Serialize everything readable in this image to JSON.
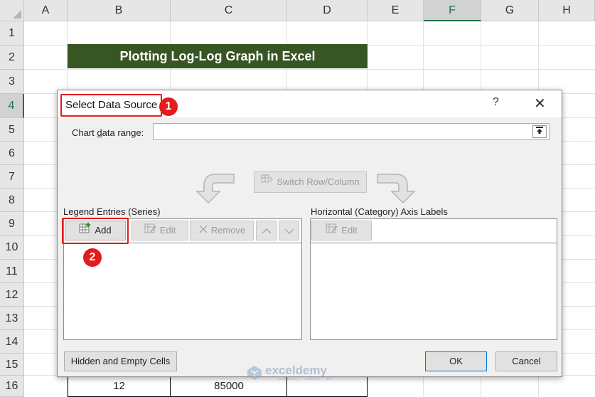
{
  "spreadsheet": {
    "columns": [
      "A",
      "B",
      "C",
      "D",
      "E",
      "F",
      "G",
      "H"
    ],
    "selected_column": "F",
    "rows": [
      "1",
      "2",
      "3",
      "4",
      "5",
      "6",
      "7",
      "8",
      "9",
      "10",
      "11",
      "12",
      "13",
      "14",
      "15",
      "16"
    ],
    "selected_row": "4",
    "banner_title": "Plotting Log-Log Graph in Excel",
    "row16": {
      "b": "12",
      "c": "85000"
    }
  },
  "dialog": {
    "title": "Select Data Source",
    "help": "?",
    "close": "✕",
    "chart_data_range_label": "Chart data range:",
    "chart_data_range_value": "",
    "switch_button": "Switch Row/Column",
    "legend_header": "Legend Entries (Series)",
    "axis_header": "Horizontal (Category) Axis Labels",
    "add_button": "Add",
    "edit_button": "Edit",
    "remove_button": "Remove",
    "axis_edit_button": "Edit",
    "hidden_cells_button": "Hidden and Empty Cells",
    "ok_button": "OK",
    "cancel_button": "Cancel"
  },
  "annotations": {
    "step1": "1",
    "step2": "2"
  },
  "watermark": {
    "name": "exceldemy",
    "tagline": "EXCEL · DATA · BI"
  },
  "colors": {
    "banner": "#375623",
    "excel_green": "#217346",
    "annotation_red": "#e21b1b"
  }
}
